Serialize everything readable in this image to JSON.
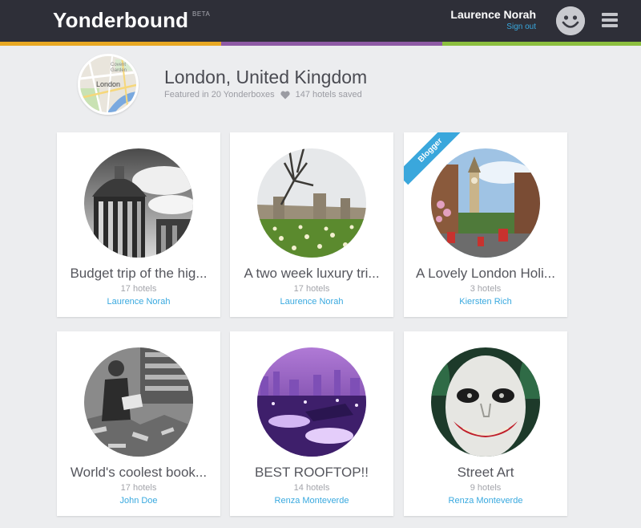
{
  "header": {
    "brand": "Yonderbound",
    "beta": "BETA",
    "user_name": "Laurence Norah",
    "sign_out": "Sign out",
    "colors": {
      "bar": "#2e2f38",
      "stripe": [
        "#e8a823",
        "#8e5aa5",
        "#8cbf3f"
      ]
    }
  },
  "location": {
    "title": "London, United Kingdom",
    "featured": "Featured in 20 Yonderboxes",
    "saved": "147 hotels saved",
    "map_labels": {
      "covent_garden_line1": "Covent",
      "covent_garden_line2": "Garden",
      "city": "London"
    }
  },
  "cards": [
    {
      "title": "Budget trip of the hig...",
      "count": "17 hotels",
      "author": "Laurence Norah",
      "image": "radcliffe-camera-bw"
    },
    {
      "title": "A two week luxury tri...",
      "count": "17 hotels",
      "author": "Laurence Norah",
      "image": "castle-daffodils"
    },
    {
      "title": "A Lovely London Holi...",
      "count": "3 hotels",
      "author": "Kiersten Rich",
      "image": "big-ben-street",
      "ribbon": "Blogger"
    },
    {
      "title": "World's coolest book...",
      "count": "17 hotels",
      "author": "John Doe",
      "image": "bookshop-ruins-bw"
    },
    {
      "title": "BEST ROOFTOP!!",
      "count": "14 hotels",
      "author": "Renza Monteverde",
      "image": "rooftop-purple"
    },
    {
      "title": "Street Art",
      "count": "9 hotels",
      "author": "Renza Monteverde",
      "image": "joker-street-art"
    }
  ]
}
